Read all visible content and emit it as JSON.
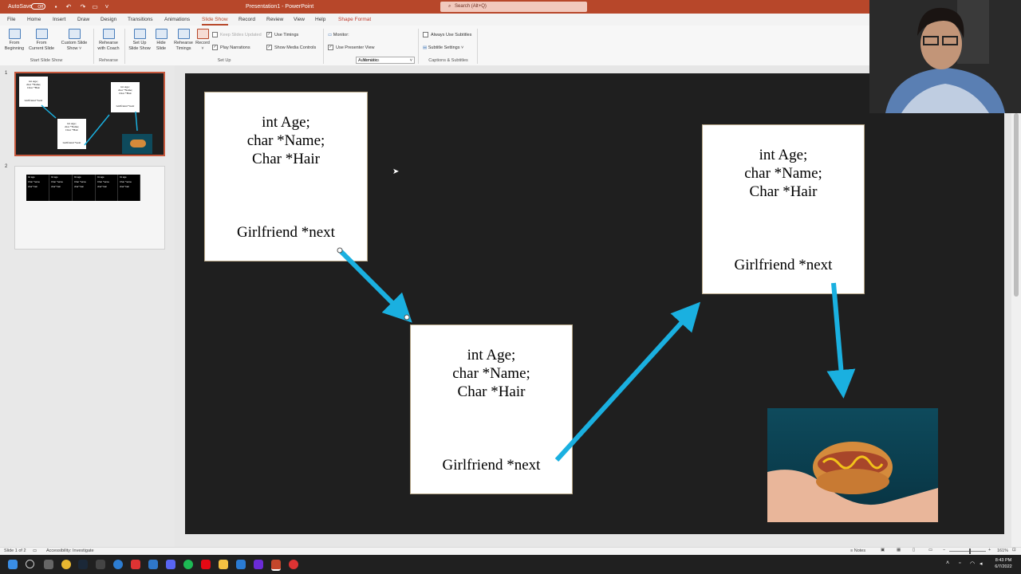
{
  "titlebar": {
    "autosave": "AutoSave",
    "autosave_state": "Off",
    "title": "Presentation1 - PowerPoint",
    "search_placeholder": "Search (Alt+Q)"
  },
  "menu": {
    "tabs": [
      "File",
      "Home",
      "Insert",
      "Draw",
      "Design",
      "Transitions",
      "Animations",
      "Slide Show",
      "Record",
      "Review",
      "View",
      "Help",
      "Shape Format"
    ],
    "active": "Slide Show"
  },
  "ribbon": {
    "start": {
      "from_beginning": [
        "From",
        "Beginning"
      ],
      "from_current": [
        "From",
        "Current Slide"
      ],
      "custom": [
        "Custom Slide",
        "Show ˅"
      ],
      "group": "Start Slide Show"
    },
    "rehearse": {
      "btn": [
        "Rehearse",
        "with Coach"
      ],
      "group": "Rehearse"
    },
    "setup": {
      "setup_show": [
        "Set Up",
        "Slide Show"
      ],
      "hide": [
        "Hide",
        "Slide"
      ],
      "rehearse_timings": [
        "Rehearse",
        "Timings"
      ],
      "record": [
        "Record",
        "˅"
      ],
      "keep_updated": "Keep Slides Updated",
      "use_timings": "Use Timings",
      "play_narrations": "Play Narrations",
      "show_media": "Show Media Controls",
      "group": "Set Up"
    },
    "monitors": {
      "monitor_label": "Monitor:",
      "monitor_value": "Automatic",
      "presenter_view": "Use Presenter View",
      "group": "Monitors"
    },
    "captions": {
      "always_subtitles": "Always Use Subtitles",
      "subtitle_settings": "Subtitle Settings ˅",
      "group": "Captions & Subtitles"
    }
  },
  "thumbnails": {
    "slide1_num": "1",
    "slide2_num": "2",
    "mini_fields": "int Age;\nchar *Name;\nChar *Hair",
    "mini_next": "Girlfriend *next",
    "mini_cells": [
      {
        "a": "Int age",
        "b": "Char *name",
        "c": "char* hair"
      },
      {
        "a": "Int age",
        "b": "Char *name",
        "c": "char* hair"
      },
      {
        "a": "Int age",
        "b": "Char *name",
        "c": "char* hair"
      },
      {
        "a": "Int age",
        "b": "Char *name",
        "c": "char* hair"
      },
      {
        "a": "Int age",
        "b": "Char *name",
        "c": "char* hair"
      }
    ]
  },
  "slide": {
    "card1": {
      "line1": "int Age;",
      "line2": "char *Name;",
      "line3": "Char *Hair",
      "next": "Girlfriend *next"
    },
    "card2": {
      "line1": "int Age;",
      "line2": "char *Name;",
      "line3": "Char *Hair",
      "next": "Girlfriend *next"
    },
    "card3": {
      "line1": "int Age;",
      "line2": "char *Name;",
      "line3": "Char *Hair",
      "next": "Girlfriend *next"
    },
    "arrow_color": "#1ab0e0"
  },
  "statusbar": {
    "slide_info": "Slide 1 of 2",
    "accessibility": "Accessibility: Investigate",
    "notes": "Notes",
    "zoom": "161%"
  },
  "taskbar": {
    "time": "8:43 PM",
    "date": "6/7/2022"
  },
  "colors": {
    "accent": "#b7472a",
    "slide_bg": "#1f1f1f",
    "taskbar": "#202020"
  }
}
